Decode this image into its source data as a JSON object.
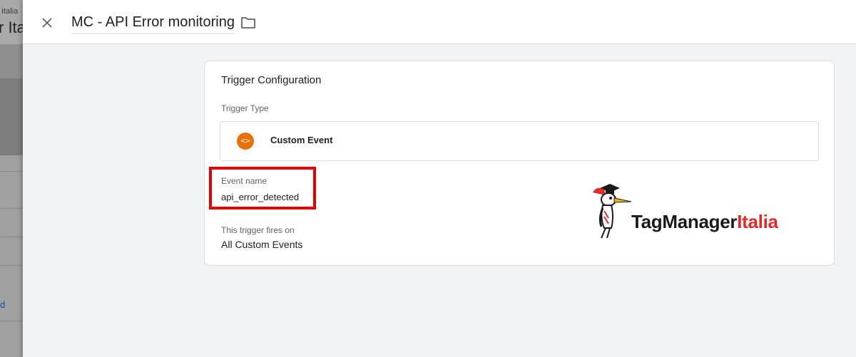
{
  "background": {
    "brand_small": "Italia",
    "brand_big": "r Ita",
    "link_fragment": "d"
  },
  "header": {
    "title": "MC - API Error monitoring",
    "close_icon": "close-icon",
    "folder_icon": "folder-icon"
  },
  "card": {
    "title": "Trigger Configuration",
    "trigger_type_label": "Trigger Type",
    "trigger_type": {
      "name": "Custom Event",
      "icon_glyph": "<>",
      "icon_color": "#e8710a"
    },
    "event_name_label": "Event name",
    "event_name_value": "api_error_detected",
    "fires_on_label": "This trigger fires on",
    "fires_on_value": "All Custom Events"
  },
  "logo": {
    "part1": "TagManager",
    "part2": "Italia"
  },
  "colors": {
    "highlight": "#e00000",
    "brand_red": "#e12a2a"
  }
}
